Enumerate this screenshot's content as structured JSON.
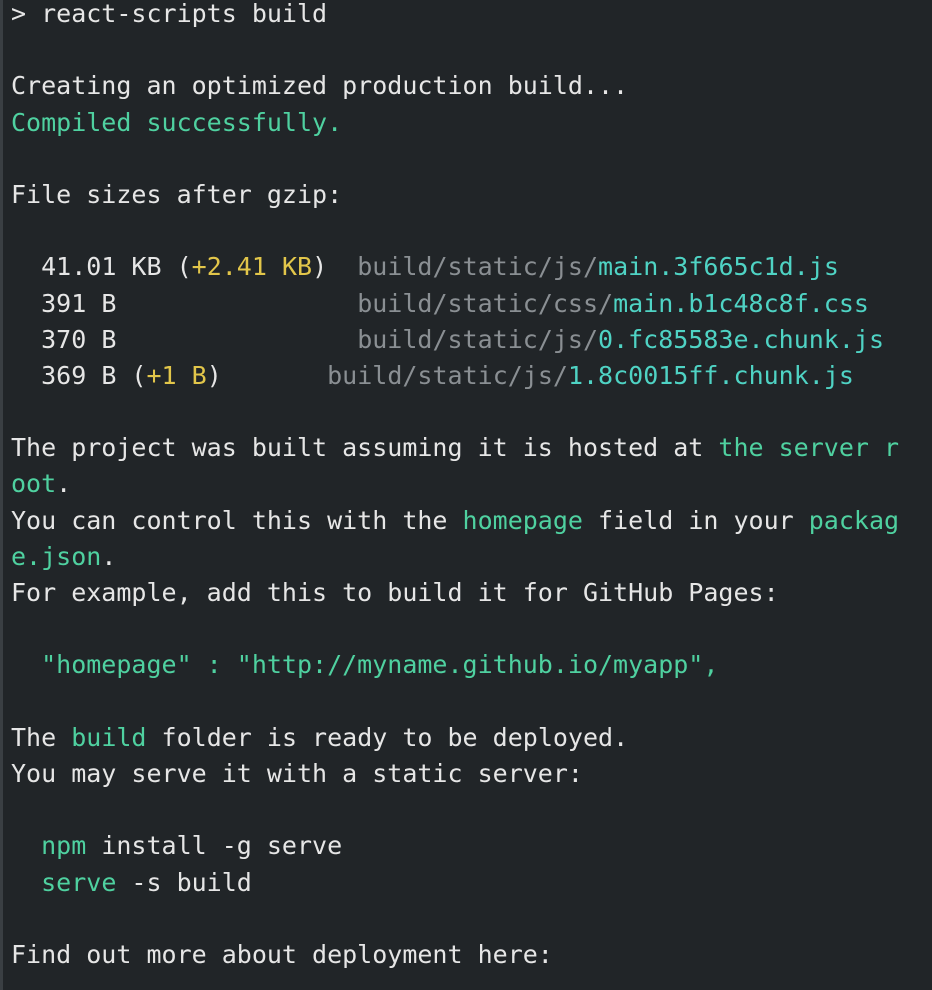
{
  "terminal": {
    "lines": {
      "cmd": "> react-scripts build",
      "creating": "Creating an optimized production build...",
      "compiled": "Compiled successfully.",
      "filesizes": "File sizes after gzip:",
      "project_a": "The project was built assuming it is hosted at ",
      "project_a_hl": "the server r",
      "project_b_hl": "oot",
      "project_b_end": ".",
      "control_a": "You can control this with the ",
      "control_hl1": "homepage",
      "control_b": " field in your ",
      "control_hl2": "packag",
      "control_c_hl": "e.json",
      "control_c_end": ".",
      "example": "For example, add this to build it for GitHub Pages:",
      "homepage_line": "  \"homepage\" : \"http://myname.github.io/myapp\",",
      "build_a": "The ",
      "build_hl": "build",
      "build_b": " folder is ready to be deployed.",
      "serve_hint": "You may serve it with a static server:",
      "npm_cmd": "npm",
      "npm_rest": " install -g serve",
      "serve_cmd": "serve",
      "serve_rest": " -s build",
      "findout": "Find out more about deployment here:"
    },
    "files": [
      {
        "size": "41.01 KB",
        "delta": "+2.41 KB",
        "dir": "build/static/js/",
        "name": "main.3f665c1d.js"
      },
      {
        "size": "391 B",
        "delta": "",
        "dir": "build/static/css/",
        "name": "main.b1c48c8f.css"
      },
      {
        "size": "370 B",
        "delta": "",
        "dir": "build/static/js/",
        "name": "0.fc85583e.chunk.js"
      },
      {
        "size": "369 B",
        "delta": "+1 B",
        "dir": "build/static/js/",
        "name": "1.8c0015ff.chunk.js"
      }
    ],
    "colors": {
      "background": "#212528",
      "text": "#e6e6e6",
      "green": "#4fd1a0",
      "yellow": "#e2c64a",
      "dim": "#8a8f93"
    }
  }
}
